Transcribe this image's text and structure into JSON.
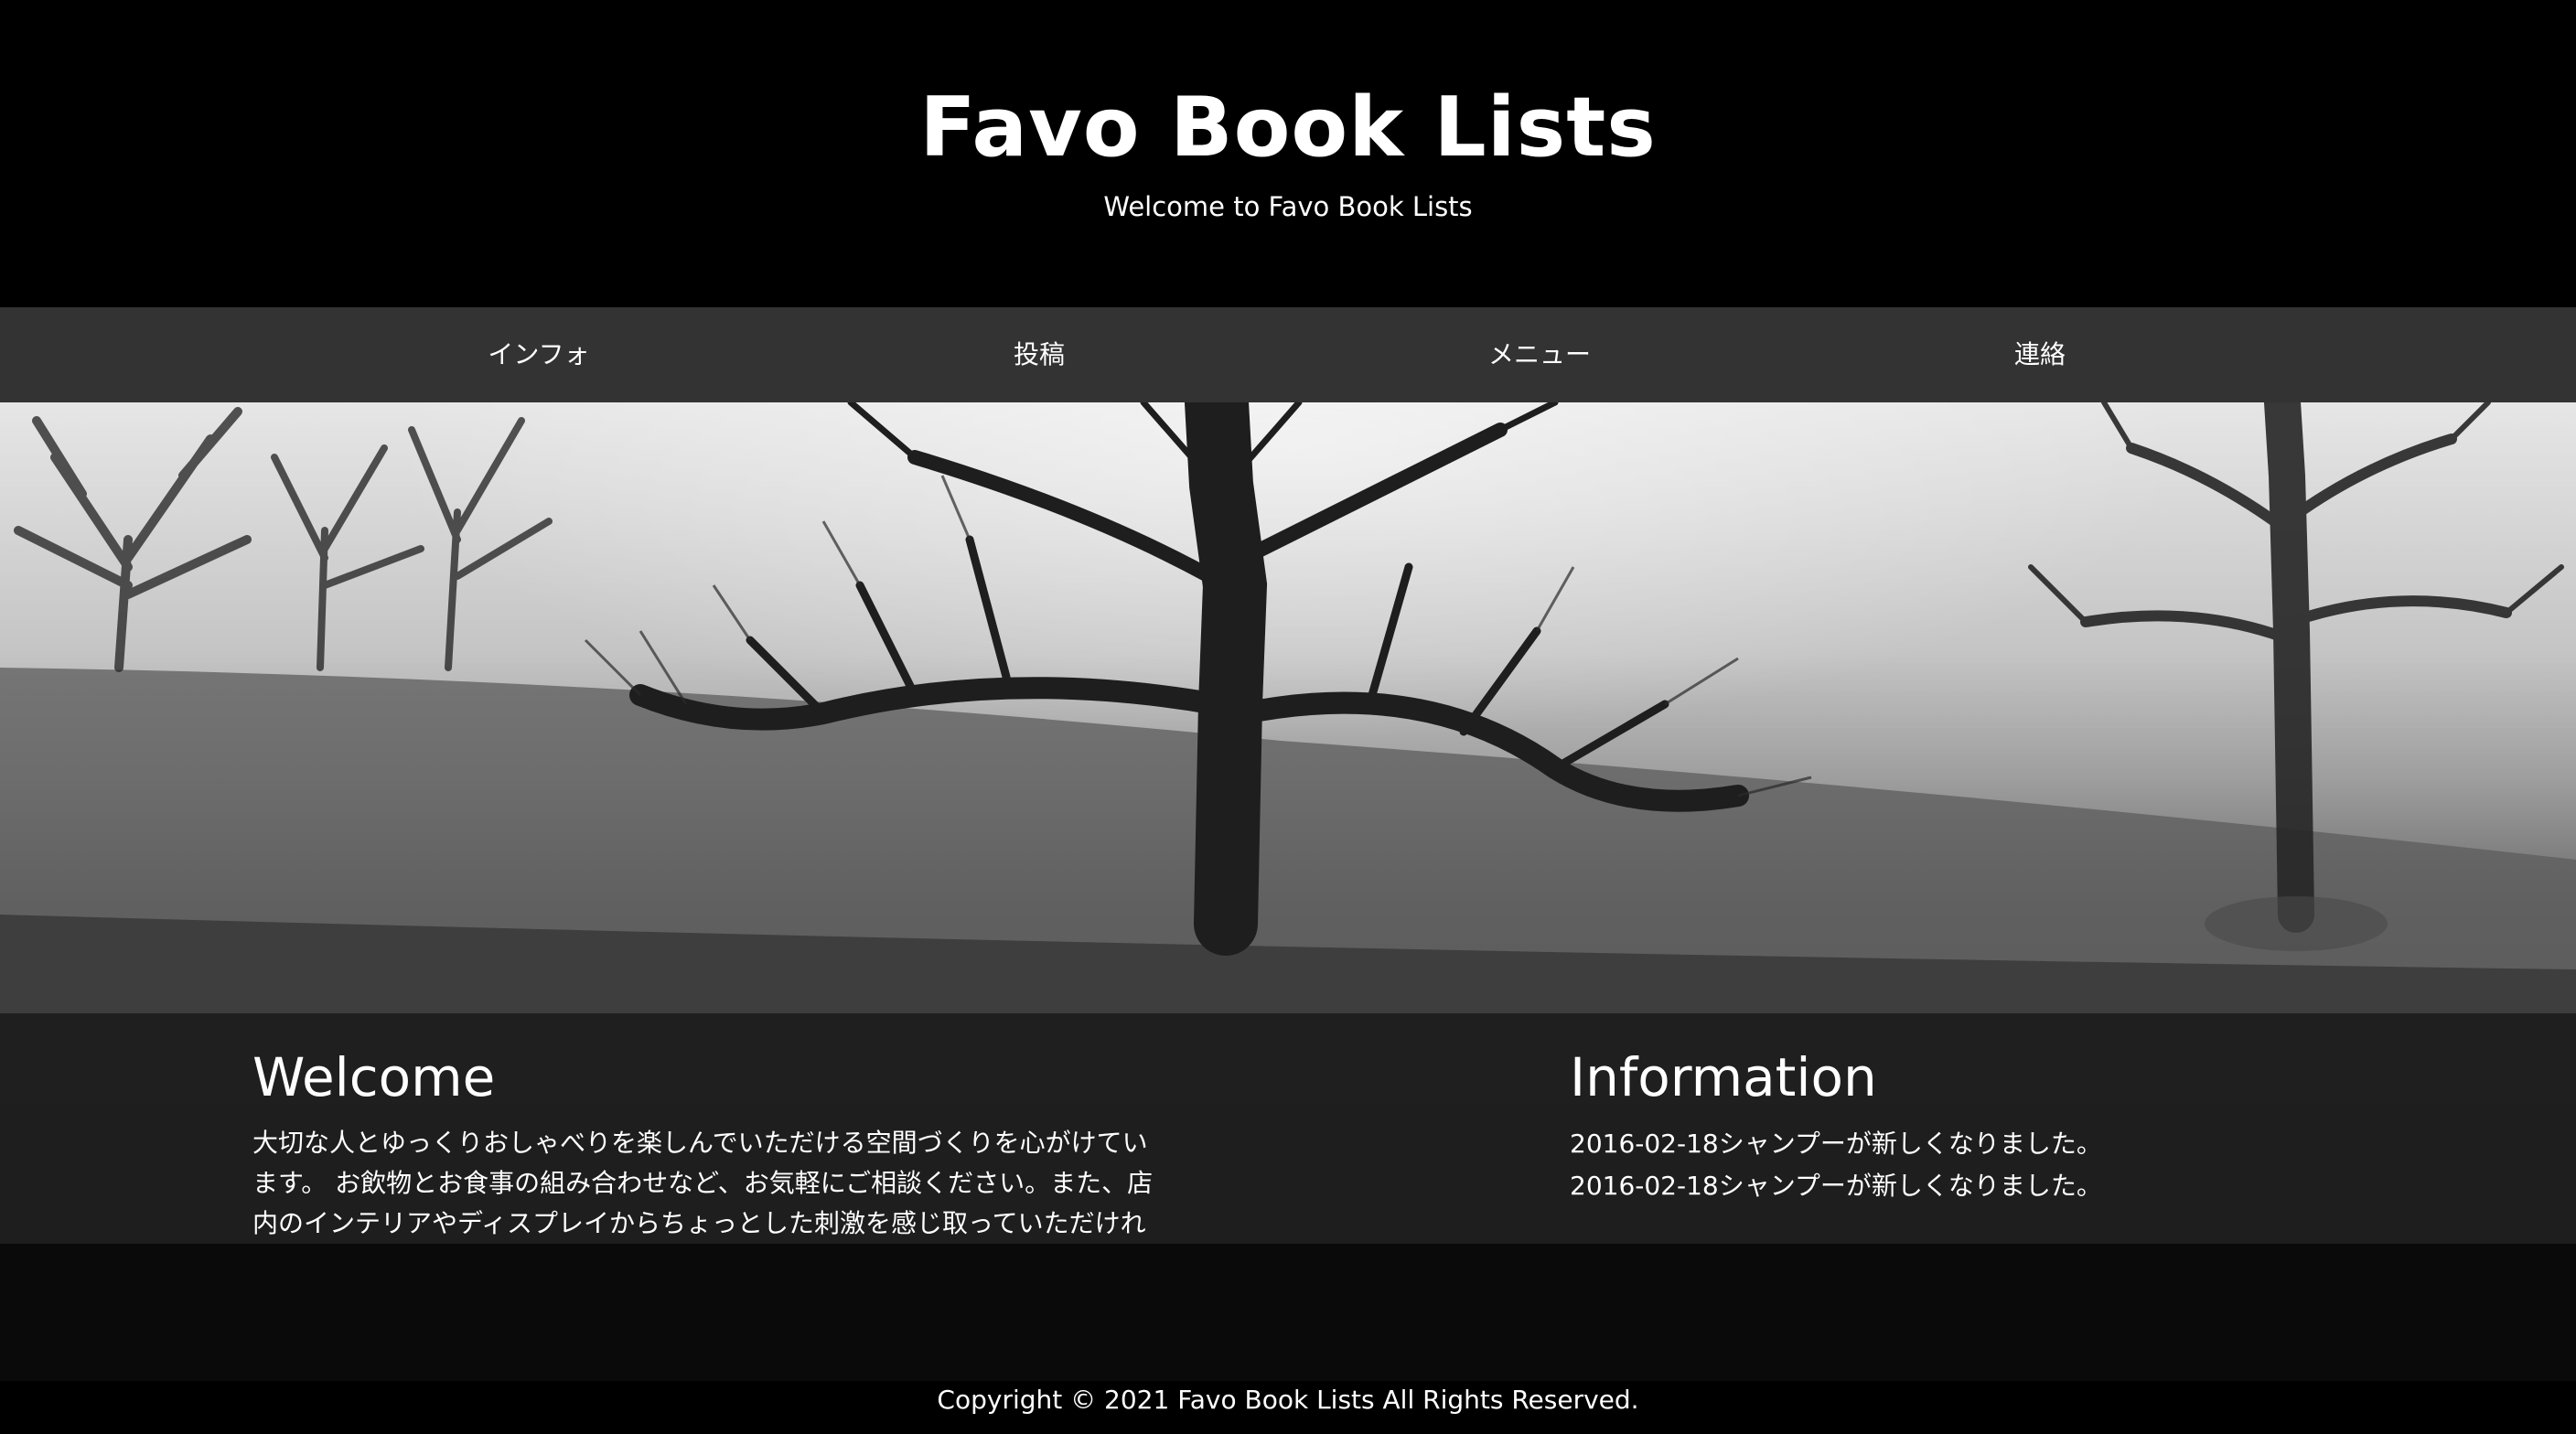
{
  "header": {
    "title": "Favo Book Lists",
    "tagline": "Welcome to Favo Book Lists"
  },
  "nav": {
    "items": [
      {
        "label": "インフォ"
      },
      {
        "label": "投稿"
      },
      {
        "label": "メニュー"
      },
      {
        "label": "連絡"
      }
    ]
  },
  "hero": {
    "image": "misty-tree-landscape"
  },
  "welcome": {
    "heading": "Welcome",
    "text": "大切な人とゆっくりおしゃべりを楽しんでいただける空間づくりを心がけています。 お飲物とお食事の組み合わせなど、お気軽にご相談ください。また、店内のインテリアやディスプレイからちょっとした刺激を感じ取っていただければ嬉しいです。"
  },
  "information": {
    "heading": "Information",
    "items": [
      {
        "text": "2016-02-18シャンプーが新しくなりました。"
      },
      {
        "text": "2016-02-18シャンプーが新しくなりました。"
      }
    ]
  },
  "footer": {
    "copyright": "Copyright © 2021 Favo Book Lists All Rights Reserved."
  },
  "colors": {
    "header_bg": "#000000",
    "nav_bg": "#333333",
    "text": "#ffffff"
  }
}
